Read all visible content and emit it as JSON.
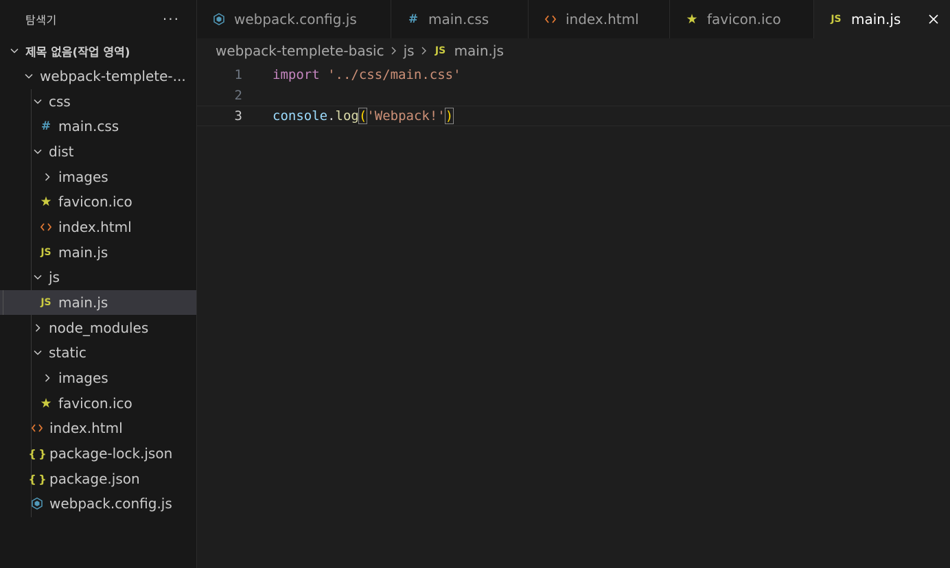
{
  "explorer": {
    "title": "탐색기",
    "more": "···",
    "root": "제목 없음(작업 영역)",
    "items": [
      {
        "label": "webpack-templete-...",
        "icon": "chevron-down"
      },
      {
        "label": "css",
        "icon": "chevron-down"
      },
      {
        "label": "main.css",
        "icon": "css-file"
      },
      {
        "label": "dist",
        "icon": "chevron-down"
      },
      {
        "label": "images",
        "icon": "chevron-right"
      },
      {
        "label": "favicon.ico",
        "icon": "star"
      },
      {
        "label": "index.html",
        "icon": "html-file"
      },
      {
        "label": "main.js",
        "icon": "js-file"
      },
      {
        "label": "js",
        "icon": "chevron-down"
      },
      {
        "label": "main.js",
        "icon": "js-file"
      },
      {
        "label": "node_modules",
        "icon": "chevron-right"
      },
      {
        "label": "static",
        "icon": "chevron-down"
      },
      {
        "label": "images",
        "icon": "chevron-right"
      },
      {
        "label": "favicon.ico",
        "icon": "star"
      },
      {
        "label": "index.html",
        "icon": "html-file"
      },
      {
        "label": "package-lock.json",
        "icon": "json-file"
      },
      {
        "label": "package.json",
        "icon": "json-file"
      },
      {
        "label": "webpack.config.js",
        "icon": "webpack-file"
      }
    ]
  },
  "tabs": [
    {
      "label": "webpack.config.js",
      "icon": "webpack-file"
    },
    {
      "label": "main.css",
      "icon": "css-file"
    },
    {
      "label": "index.html",
      "icon": "html-file"
    },
    {
      "label": "favicon.ico",
      "icon": "star"
    },
    {
      "label": "main.js",
      "icon": "js-file",
      "active": true
    }
  ],
  "breadcrumb": [
    "webpack-templete-basic",
    "js",
    "main.js"
  ],
  "editor": {
    "line_numbers": [
      "1",
      "2",
      "3"
    ],
    "line1": {
      "kw": "import",
      "str": "'../css/main.css'"
    },
    "line3": {
      "obj": "console",
      "dot": ".",
      "fn": "log",
      "open": "(",
      "str": "'Webpack!'",
      "close": ")"
    },
    "current_line": 3
  },
  "icon_glyphs": {
    "css": "#",
    "html": "<>",
    "js": "JS",
    "json": "{ }",
    "star": "★"
  },
  "colors": {
    "js": "#cbcb41",
    "css": "#519aba",
    "html": "#e37933",
    "keyword": "#c586c0",
    "string": "#ce9178",
    "function": "#dcdcaa",
    "identifier": "#9cdcfe"
  }
}
